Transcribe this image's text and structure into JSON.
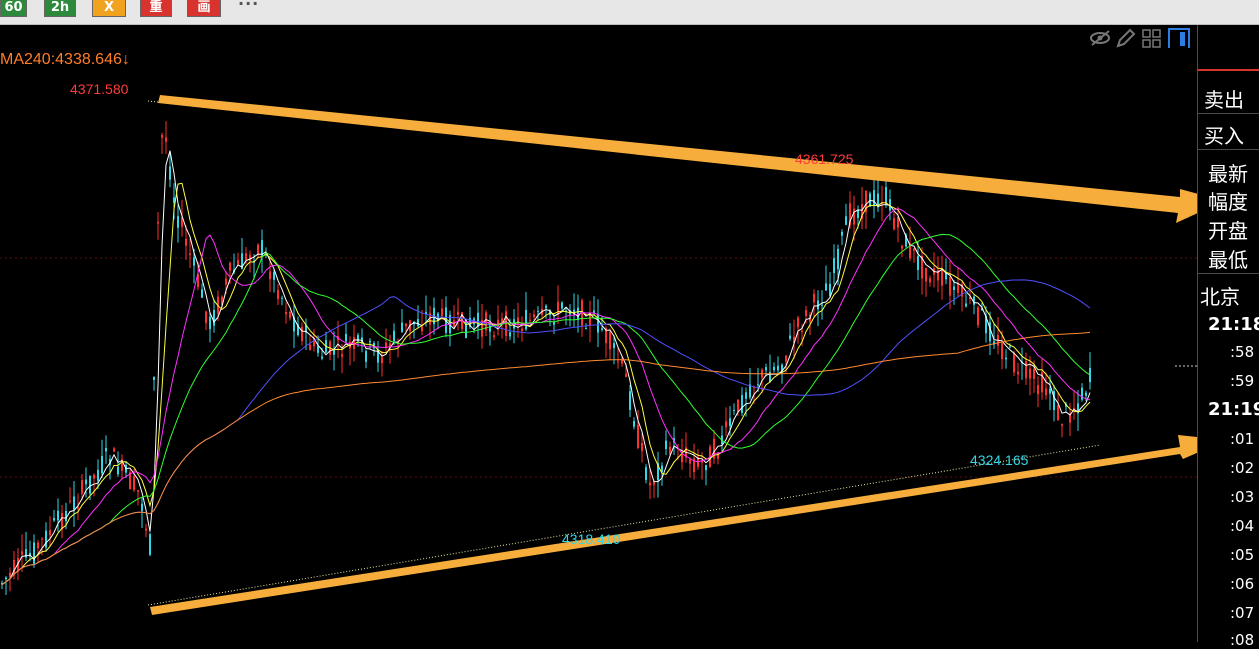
{
  "toolbar": {
    "buttons": [
      {
        "id": "60",
        "label": "60",
        "color": "#2d8a3c"
      },
      {
        "id": "2h",
        "label": "2h",
        "color": "#2d8a3c"
      },
      {
        "id": "x",
        "label": "X",
        "color": "#f1a21f"
      },
      {
        "id": "zh",
        "label": "重",
        "color": "#d8332e"
      },
      {
        "id": "pic",
        "label": "画",
        "color": "#d8332e"
      }
    ],
    "more": "···"
  },
  "chart": {
    "ma_label": "MA240:4338.646↓",
    "annotations": {
      "high": "4371.580",
      "peak": "4361.725",
      "low1": "4318.410",
      "low2": "4324.165"
    },
    "colors": {
      "up_candle": "#ff3030",
      "down_candle": "#30d8e8",
      "ma5": "#ffffff",
      "ma10": "#ffff40",
      "ma20": "#ff30ff",
      "ma30": "#30ff30",
      "ma60": "#5050ff",
      "ma240": "#ff8a30",
      "trend_arrow": "#f6ad3b"
    },
    "tool_icons": [
      "eye-hide-icon",
      "pencil-icon",
      "grid-icon",
      "panel-icon"
    ]
  },
  "panel": {
    "labels": [
      "卖出",
      "买入",
      "最新",
      "幅度",
      "开盘",
      "最低",
      "北京"
    ],
    "times": [
      {
        "text": "21:18",
        "size": "big"
      },
      {
        "text": ":58",
        "size": "small"
      },
      {
        "text": ":59",
        "size": "small"
      },
      {
        "text": "21:19",
        "size": "big"
      },
      {
        "text": ":01",
        "size": "small"
      },
      {
        "text": ":02",
        "size": "small"
      },
      {
        "text": ":03",
        "size": "small"
      },
      {
        "text": ":04",
        "size": "small"
      },
      {
        "text": ":05",
        "size": "small"
      },
      {
        "text": ":06",
        "size": "small"
      },
      {
        "text": ":07",
        "size": "small"
      },
      {
        "text": ":08",
        "size": "small"
      }
    ]
  }
}
